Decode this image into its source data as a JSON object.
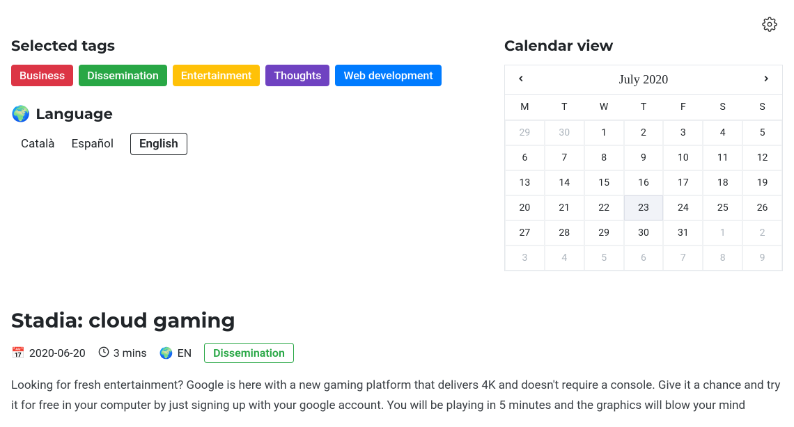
{
  "headings": {
    "tags": "Selected tags",
    "language": "Language",
    "calendar": "Calendar view"
  },
  "tags": [
    {
      "label": "Business",
      "color": "red"
    },
    {
      "label": "Dissemination",
      "color": "green"
    },
    {
      "label": "Entertainment",
      "color": "yellow"
    },
    {
      "label": "Thoughts",
      "color": "purple"
    },
    {
      "label": "Web development",
      "color": "blue"
    }
  ],
  "languages": {
    "items": [
      "Català",
      "Español",
      "English"
    ],
    "active_index": 2
  },
  "calendar": {
    "title": "July 2020",
    "days_of_week": [
      "M",
      "T",
      "W",
      "T",
      "F",
      "S",
      "S"
    ],
    "cells": [
      {
        "n": 29,
        "muted": true
      },
      {
        "n": 30,
        "muted": true
      },
      {
        "n": 1
      },
      {
        "n": 2
      },
      {
        "n": 3
      },
      {
        "n": 4
      },
      {
        "n": 5
      },
      {
        "n": 6
      },
      {
        "n": 7
      },
      {
        "n": 8
      },
      {
        "n": 9
      },
      {
        "n": 10
      },
      {
        "n": 11
      },
      {
        "n": 12
      },
      {
        "n": 13
      },
      {
        "n": 14
      },
      {
        "n": 15
      },
      {
        "n": 16
      },
      {
        "n": 17
      },
      {
        "n": 18
      },
      {
        "n": 19
      },
      {
        "n": 20
      },
      {
        "n": 21
      },
      {
        "n": 22
      },
      {
        "n": 23,
        "today": true
      },
      {
        "n": 24
      },
      {
        "n": 25
      },
      {
        "n": 26
      },
      {
        "n": 27
      },
      {
        "n": 28
      },
      {
        "n": 29
      },
      {
        "n": 30
      },
      {
        "n": 31
      },
      {
        "n": 1,
        "muted": true
      },
      {
        "n": 2,
        "muted": true
      },
      {
        "n": 3,
        "muted": true
      },
      {
        "n": 4,
        "muted": true
      },
      {
        "n": 5,
        "muted": true
      },
      {
        "n": 6,
        "muted": true
      },
      {
        "n": 7,
        "muted": true
      },
      {
        "n": 8,
        "muted": true
      },
      {
        "n": 9,
        "muted": true
      }
    ]
  },
  "article": {
    "title": "Stadia: cloud gaming",
    "date": "2020-06-20",
    "read_time": "3 mins",
    "language": "EN",
    "tag": "Dissemination",
    "excerpt": "Looking for fresh entertainment? Google is here with a new gaming platform that delivers 4K and doesn't require a console. Give it a chance and try it for free in your computer by just signing up with your google account. You will be playing in 5 minutes and the graphics will blow your mind"
  }
}
